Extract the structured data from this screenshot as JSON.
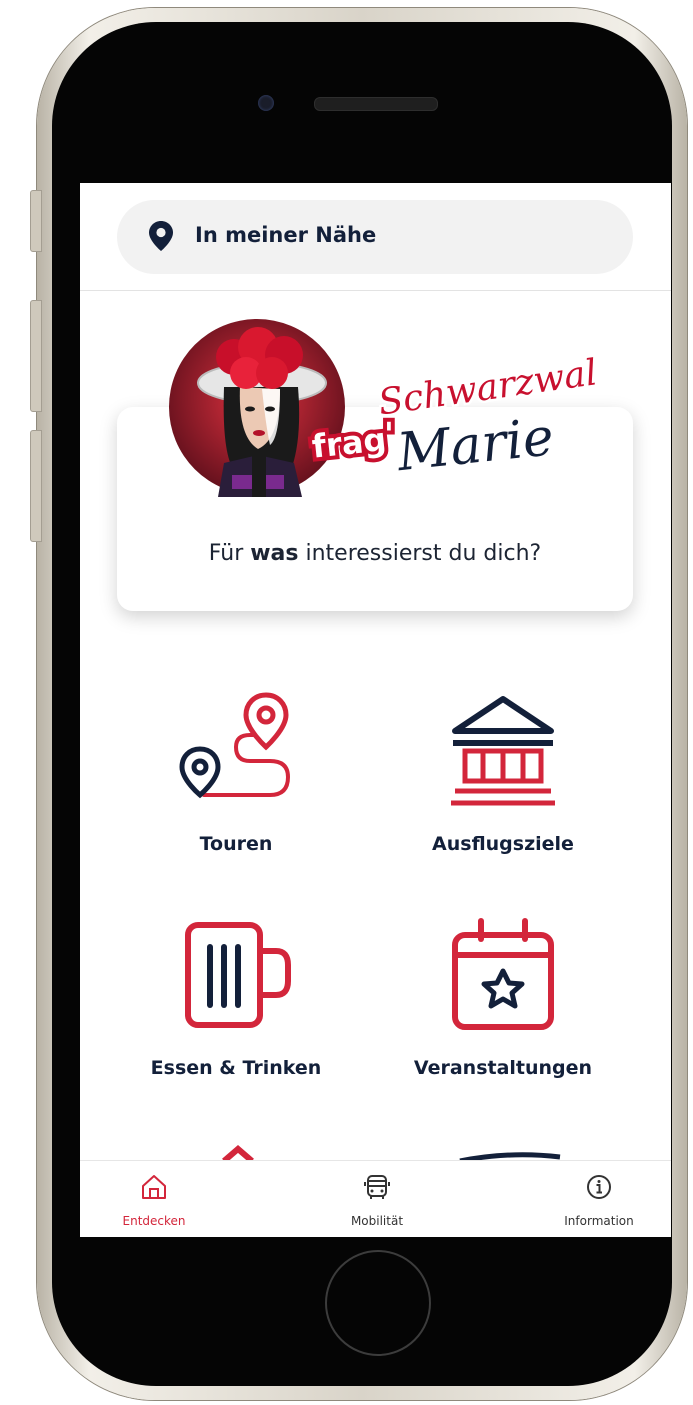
{
  "location_bar": {
    "icon": "map-pin-icon",
    "label": "In meiner Nähe"
  },
  "intro": {
    "logo_text": {
      "line1": "Schwarzwald",
      "frag": "frag",
      "apostrophe": "'",
      "marie": "Marie"
    },
    "question_prefix": "Für ",
    "question_bold": "was",
    "question_suffix": " interessierst du dich?"
  },
  "categories": [
    {
      "label": "Touren",
      "icon": "route-icon"
    },
    {
      "label": "Ausflugsziele",
      "icon": "museum-icon"
    },
    {
      "label": "Essen & Trinken",
      "icon": "beer-mug-icon"
    },
    {
      "label": "Veranstaltungen",
      "icon": "calendar-star-icon"
    }
  ],
  "tabbar": {
    "active_index": 0,
    "tabs": [
      {
        "label": "Entdecken",
        "icon": "home-icon"
      },
      {
        "label": "Mobilität",
        "icon": "bus-icon"
      },
      {
        "label": "Information",
        "icon": "info-icon"
      }
    ]
  },
  "colors": {
    "accent": "#d3263b",
    "navy": "#13203a",
    "tab_active": "#d3263b"
  }
}
